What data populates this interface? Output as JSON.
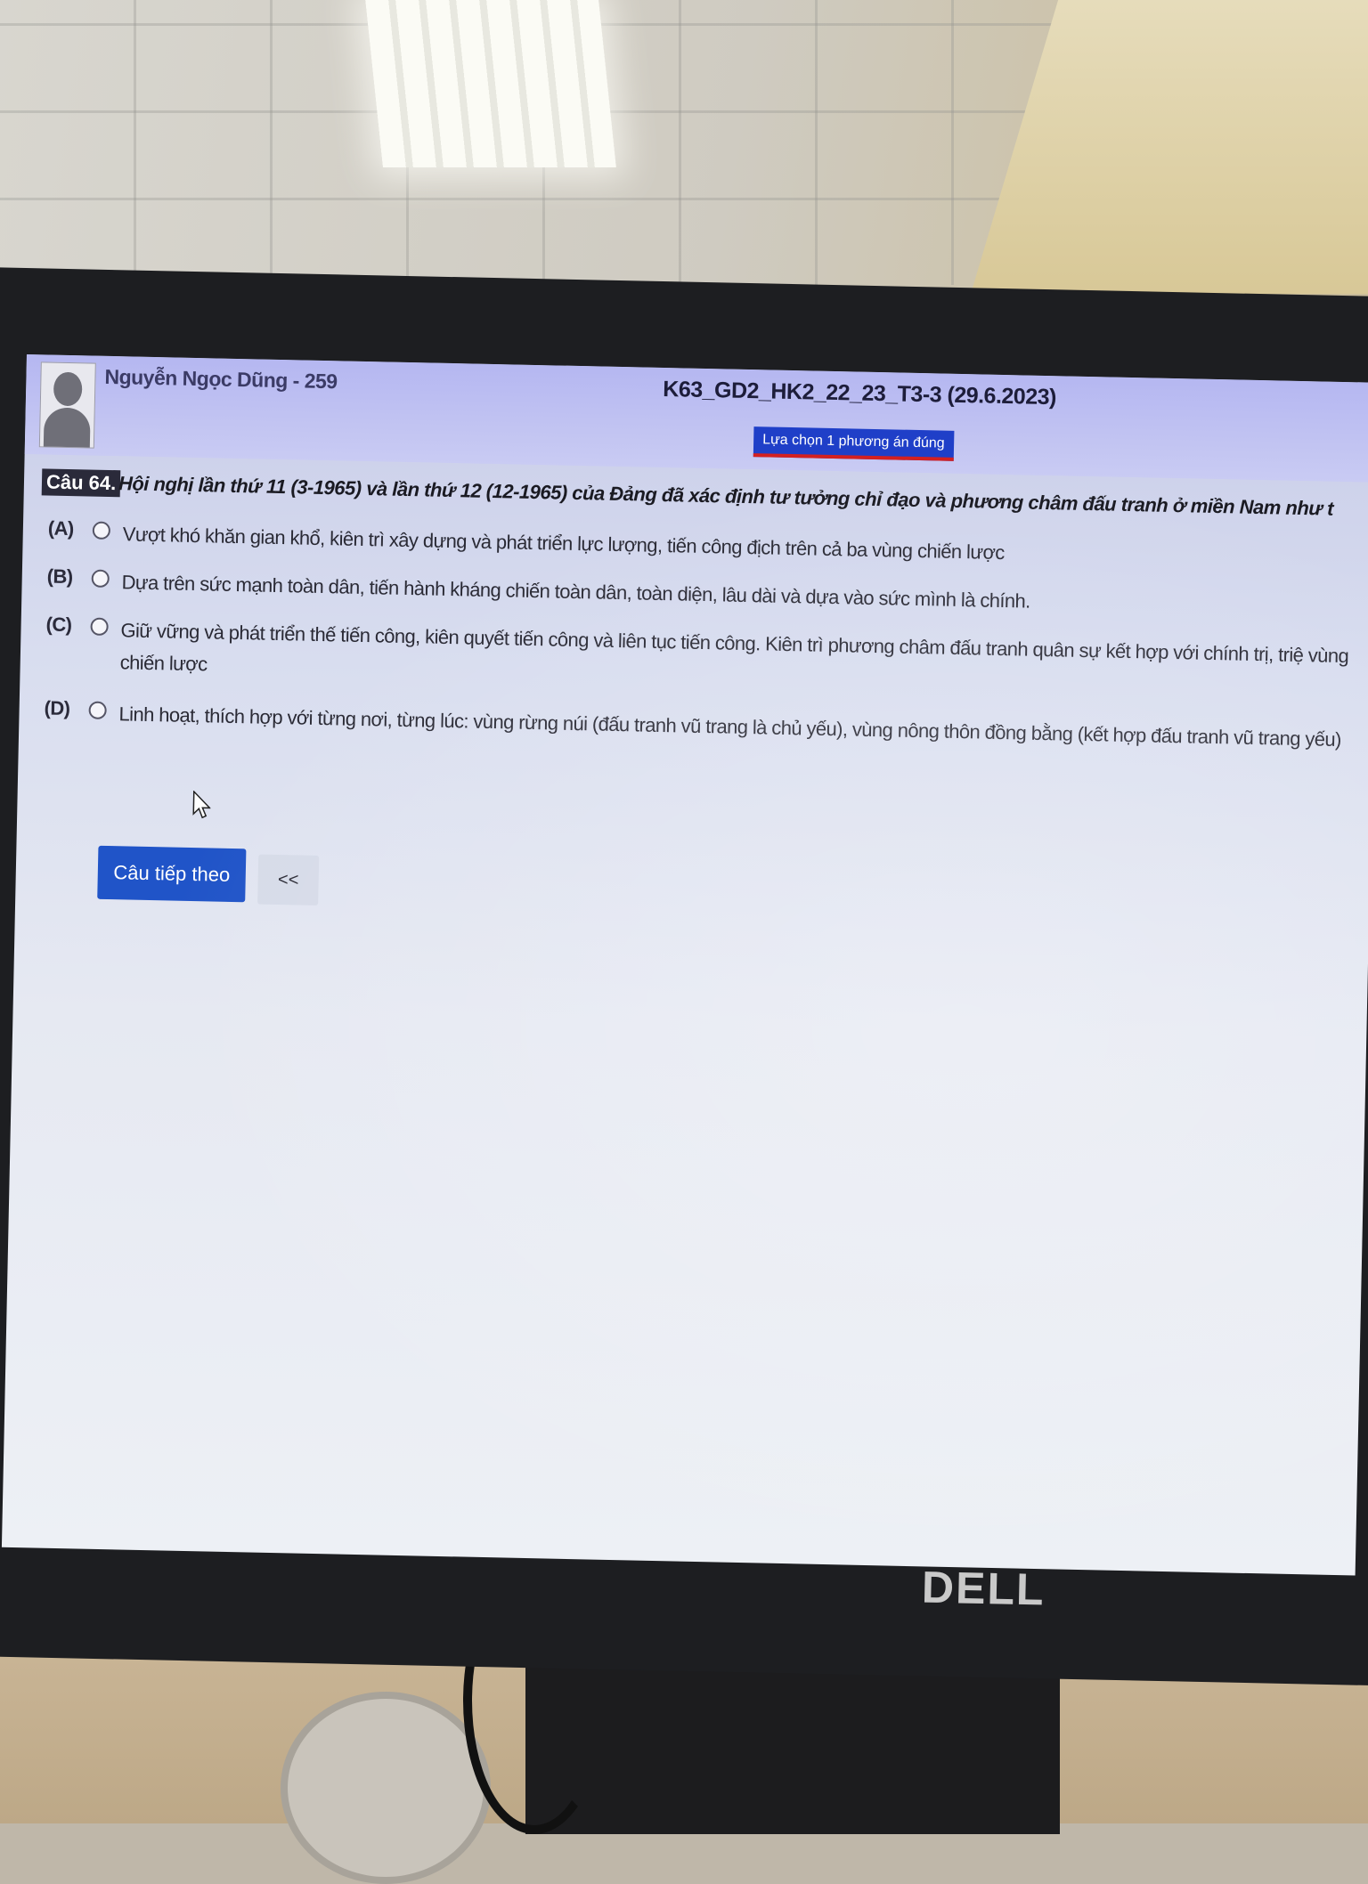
{
  "header": {
    "student_name": "Nguyễn Ngọc Dũng - 259",
    "exam_title": "K63_GD2_HK2_22_23_T3-3 (29.6.2023)",
    "instruction": "Lựa chọn 1 phương án đúng"
  },
  "question": {
    "number": "Câu 64.",
    "text": "Hội nghị lần thứ 11 (3-1965) và lần thứ 12 (12-1965) của Đảng đã xác định tư tưởng chỉ đạo và phương châm đấu tranh ở miền Nam như t"
  },
  "options": [
    {
      "letter": "(A)",
      "text": "Vượt khó khăn gian khổ, kiên trì xây dựng và phát triển lực lượng, tiến công địch trên cả ba vùng chiến lược"
    },
    {
      "letter": "(B)",
      "text": "Dựa trên sức mạnh toàn dân, tiến hành kháng chiến toàn dân, toàn diện, lâu dài và dựa vào sức mình là chính."
    },
    {
      "letter": "(C)",
      "text": "Giữ vững và phát triển thế tiến công, kiên quyết tiến công và liên tục tiến công. Kiên trì phương châm đấu tranh quân sự kết hợp với chính trị, triệ vùng chiến lược"
    },
    {
      "letter": "(D)",
      "text": "Linh hoạt, thích hợp với từng nơi, từng lúc: vùng rừng núi (đấu tranh vũ trang là chủ yếu), vùng nông thôn đồng bằng (kết hợp đấu tranh vũ trang yếu)"
    }
  ],
  "navigation": {
    "next_label": "Câu tiếp theo",
    "prev_label": "<<"
  },
  "brand": "DELL",
  "colors": {
    "header_bg": "#b5b7f1",
    "instruction_bg": "#1f3fc8",
    "next_button_bg": "#2054c8"
  }
}
